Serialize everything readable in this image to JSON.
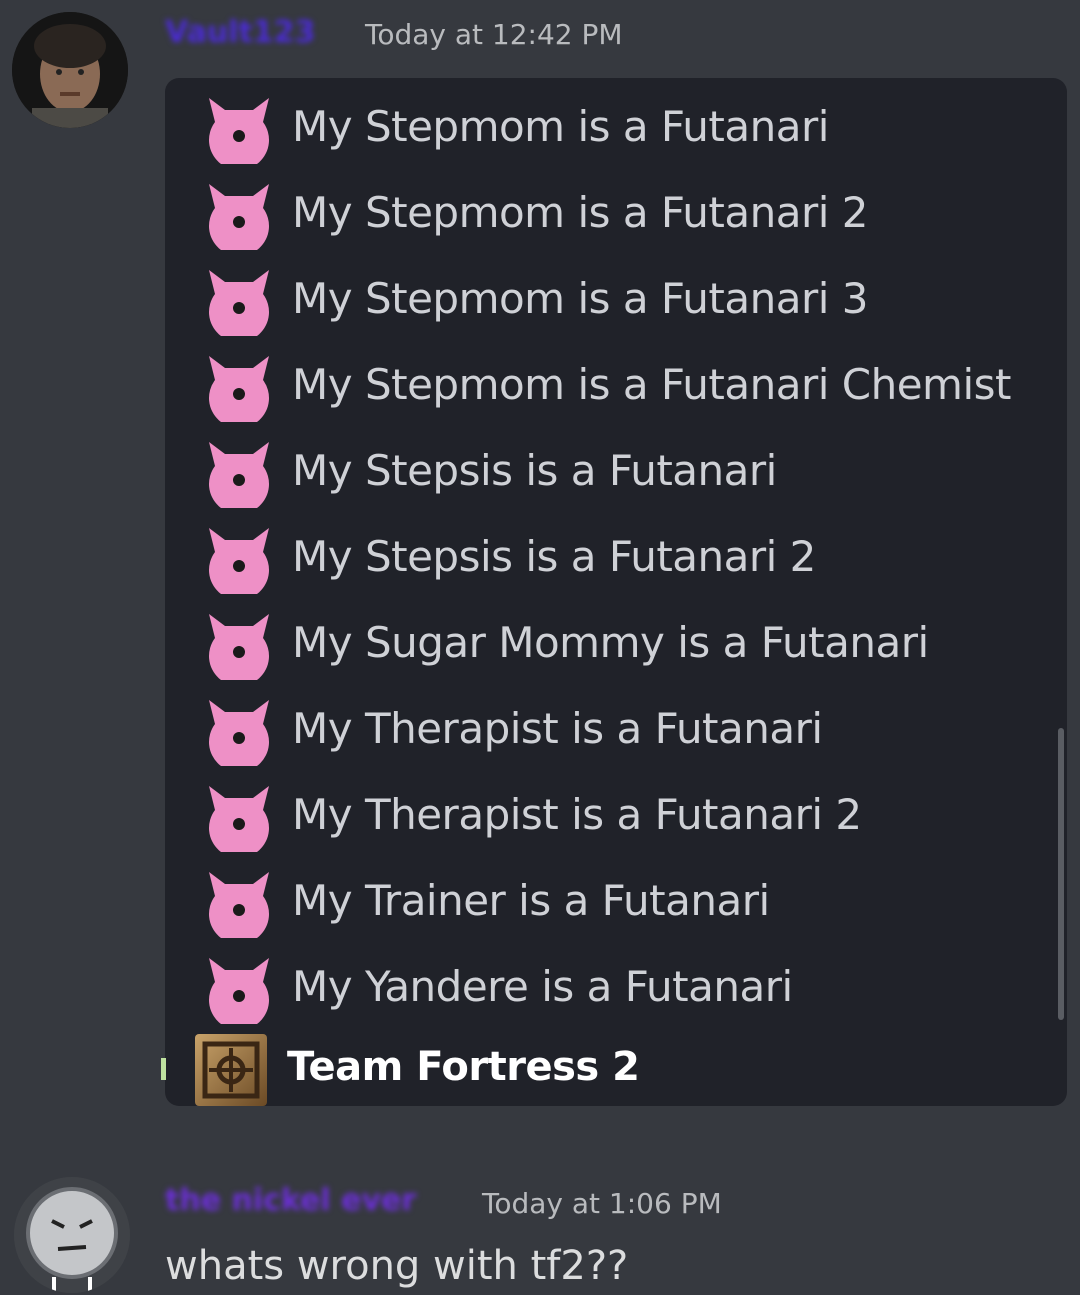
{
  "messages": [
    {
      "username": "Vault123",
      "timestamp": "Today at 12:42 PM",
      "games": [
        {
          "name": "My Stepmom is a Futanari",
          "icon": "pink-devil-icon"
        },
        {
          "name": "My Stepmom is a Futanari 2",
          "icon": "pink-devil-icon"
        },
        {
          "name": "My Stepmom is a Futanari 3",
          "icon": "pink-devil-icon"
        },
        {
          "name": "My Stepmom is a Futanari Chemist",
          "icon": "pink-devil-icon"
        },
        {
          "name": "My Stepsis is a Futanari",
          "icon": "pink-devil-icon"
        },
        {
          "name": "My Stepsis is a Futanari 2",
          "icon": "pink-devil-icon"
        },
        {
          "name": "My Sugar Mommy is a Futanari",
          "icon": "pink-devil-icon"
        },
        {
          "name": "My Therapist is a Futanari",
          "icon": "pink-devil-icon"
        },
        {
          "name": "My Therapist is a Futanari 2",
          "icon": "pink-devil-icon"
        },
        {
          "name": "My Trainer is a Futanari",
          "icon": "pink-devil-icon"
        },
        {
          "name": "My Yandere is a Futanari",
          "icon": "pink-devil-icon"
        },
        {
          "name": "Team Fortress 2",
          "icon": "tf2-icon",
          "selected": true
        }
      ]
    },
    {
      "username": "the nickel ever",
      "timestamp": "Today at 1:06 PM",
      "text": "whats wrong with tf2??"
    }
  ],
  "colors": {
    "background": "#36393f",
    "list_background": "#202229",
    "icon_pink": "#ee90c6",
    "username_1": "#4b2bd6",
    "username_2": "#6c2fd8"
  }
}
